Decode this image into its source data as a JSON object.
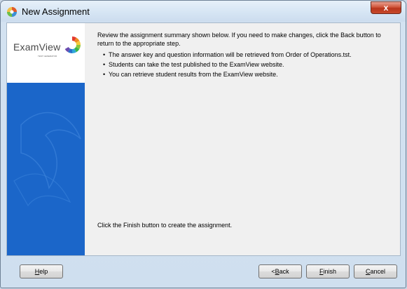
{
  "window": {
    "title": "New Assignment",
    "close_label": "x"
  },
  "sidebar": {
    "logo_text": "ExamView",
    "logo_subtext": "TEST GENERATOR",
    "logo_icon": "examview-logo-icon"
  },
  "content": {
    "intro": "Review the assignment summary shown below. If you need to make changes, click the Back button to return to the appropriate step.",
    "bullets": [
      "The answer key and question information will be retrieved from Order of Operations.tst.",
      "Students can take the test published to the ExamView website.",
      "You can retrieve student results from the ExamView website."
    ],
    "finish_note": "Click the Finish button to create the assignment."
  },
  "buttons": {
    "help": {
      "prefix": "",
      "mnemonic": "H",
      "rest": "elp"
    },
    "back": {
      "prefix": "< ",
      "mnemonic": "B",
      "rest": "ack"
    },
    "finish": {
      "prefix": "",
      "mnemonic": "F",
      "rest": "inish"
    },
    "cancel": {
      "prefix": "",
      "mnemonic": "C",
      "rest": "ancel"
    }
  },
  "colors": {
    "sidebar_blue": "#1b66c9",
    "close_button": "#c84a2c"
  }
}
